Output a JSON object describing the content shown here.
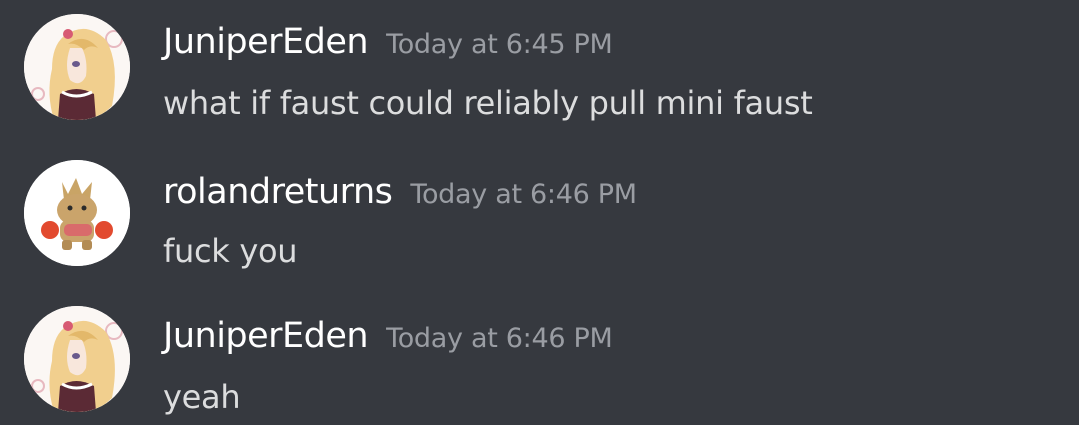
{
  "messages": [
    {
      "username": "JuniperEden",
      "timestamp": "Today at 6:45 PM",
      "text": "what if faust could reliably pull mini faust",
      "avatar_icon": "anime-girl-avatar-icon"
    },
    {
      "username": "rolandreturns",
      "timestamp": "Today at 6:46 PM",
      "text": "fuck you",
      "avatar_icon": "plush-toy-avatar-icon"
    },
    {
      "username": "JuniperEden",
      "timestamp": "Today at 6:46 PM",
      "text": "yeah",
      "avatar_icon": "anime-girl-avatar-icon"
    }
  ],
  "colors": {
    "background": "#36393f",
    "username": "#ffffff",
    "timestamp": "#9a9da3",
    "message_text": "#dcddde"
  }
}
